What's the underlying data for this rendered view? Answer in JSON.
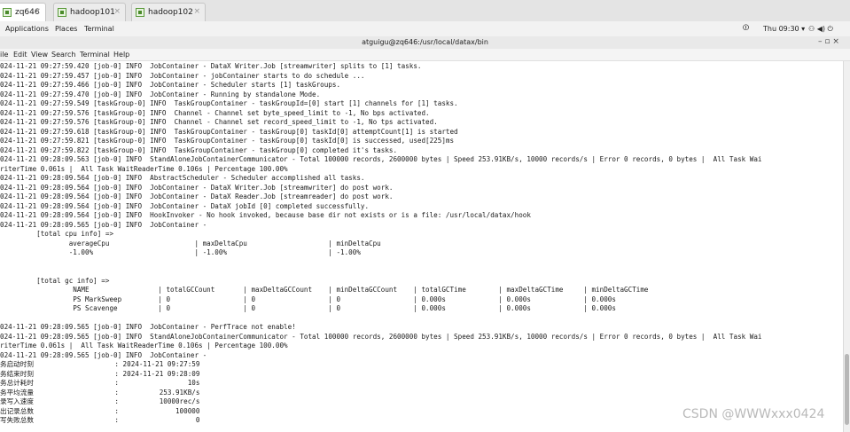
{
  "tabs": [
    {
      "label": "zq646",
      "active": true
    },
    {
      "label": "hadoop101",
      "active": false
    },
    {
      "label": "hadoop102",
      "active": false
    }
  ],
  "tab_close": "×",
  "desktop_menu": {
    "applications": "Applications",
    "places": "Places",
    "terminal": "Terminal"
  },
  "tray": {
    "time": "Thu 09:30 ▾",
    "icons": "⚇ ◀) ⏻"
  },
  "window": {
    "title": "atguigu@zq646:/usr/local/datax/bin",
    "controls": "– ▫ ×"
  },
  "terminal_menu": [
    "ile",
    "Edit",
    "View",
    "Search",
    "Terminal",
    "Help"
  ],
  "lines": [
    "024-11-21 09:27:59.420 [job-0] INFO  JobContainer - DataX Writer.Job [streamwriter] splits to [1] tasks.",
    "024-11-21 09:27:59.457 [job-0] INFO  JobContainer - jobContainer starts to do schedule ...",
    "024-11-21 09:27:59.466 [job-0] INFO  JobContainer - Scheduler starts [1] taskGroups.",
    "024-11-21 09:27:59.470 [job-0] INFO  JobContainer - Running by standalone Mode.",
    "024-11-21 09:27:59.549 [taskGroup-0] INFO  TaskGroupContainer - taskGroupId=[0] start [1] channels for [1] tasks.",
    "024-11-21 09:27:59.576 [taskGroup-0] INFO  Channel - Channel set byte_speed_limit to -1, No bps activated.",
    "024-11-21 09:27:59.576 [taskGroup-0] INFO  Channel - Channel set record_speed_limit to -1, No tps activated.",
    "024-11-21 09:27:59.618 [taskGroup-0] INFO  TaskGroupContainer - taskGroup[0] taskId[0] attemptCount[1] is started",
    "024-11-21 09:27:59.821 [taskGroup-0] INFO  TaskGroupContainer - taskGroup[0] taskId[0] is successed, used[225]ms",
    "024-11-21 09:27:59.822 [taskGroup-0] INFO  TaskGroupContainer - taskGroup[0] completed it's tasks.",
    "024-11-21 09:28:09.563 [job-0] INFO  StandAloneJobContainerCommunicator - Total 100000 records, 2600000 bytes | Speed 253.91KB/s, 10000 records/s | Error 0 records, 0 bytes |  All Task Wai",
    "riterTime 0.061s |  All Task WaitReaderTime 0.106s | Percentage 100.00%",
    "024-11-21 09:28:09.564 [job-0] INFO  AbstractScheduler - Scheduler accomplished all tasks.",
    "024-11-21 09:28:09.564 [job-0] INFO  JobContainer - DataX Writer.Job [streamwriter] do post work.",
    "024-11-21 09:28:09.564 [job-0] INFO  JobContainer - DataX Reader.Job [streamreader] do post work.",
    "024-11-21 09:28:09.564 [job-0] INFO  JobContainer - DataX jobId [0] completed successfully.",
    "024-11-21 09:28:09.564 [job-0] INFO  HookInvoker - No hook invoked, because base dir not exists or is a file: /usr/local/datax/hook",
    "024-11-21 09:28:09.565 [job-0] INFO  JobContainer -",
    "         [total cpu info] =>",
    "                 averageCpu                     | maxDeltaCpu                    | minDeltaCpu",
    "                 -1.00%                         | -1.00%                         | -1.00%",
    "",
    "",
    "         [total gc info] =>",
    "                  NAME                 | totalGCCount       | maxDeltaGCCount    | minDeltaGCCount    | totalGCTime        | maxDeltaGCTime     | minDeltaGCTime",
    "                  PS MarkSweep         | 0                  | 0                  | 0                  | 0.000s             | 0.000s             | 0.000s",
    "                  PS Scavenge          | 0                  | 0                  | 0                  | 0.000s             | 0.000s             | 0.000s",
    "",
    "024-11-21 09:28:09.565 [job-0] INFO  JobContainer - PerfTrace not enable!",
    "024-11-21 09:28:09.565 [job-0] INFO  StandAloneJobContainerCommunicator - Total 100000 records, 2600000 bytes | Speed 253.91KB/s, 10000 records/s | Error 0 records, 0 bytes |  All Task Wai",
    "riterTime 0.061s |  All Task WaitReaderTime 0.106s | Percentage 100.00%",
    "024-11-21 09:28:09.565 [job-0] INFO  JobContainer -",
    "务启动时刻                    : 2024-11-21 09:27:59",
    "务结束时刻                    : 2024-11-21 09:28:09",
    "务总计耗时                    :                 10s",
    "务平均流量                    :          253.91KB/s",
    "录写入速度                    :          10000rec/s",
    "出记录总数                    :              100000",
    "写失败总数                    :                   0"
  ],
  "watermark": "CSDN @WWWxxx0424"
}
